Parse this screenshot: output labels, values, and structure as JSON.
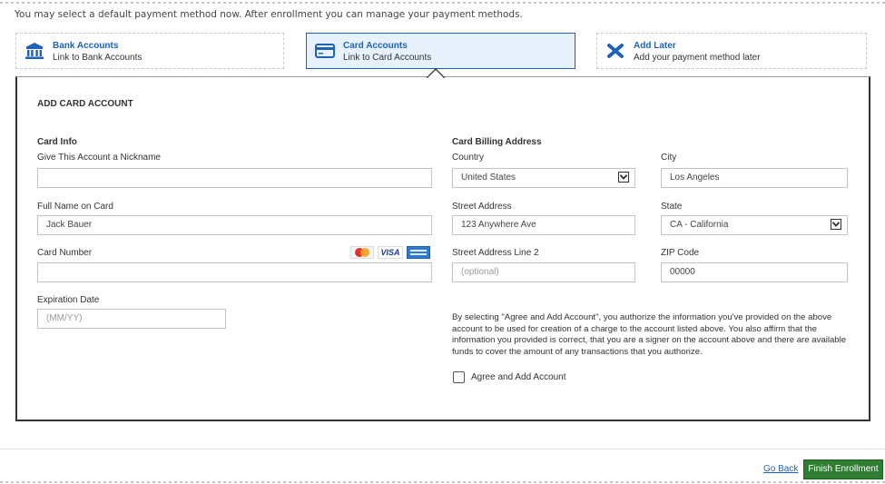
{
  "intro": "You may select a default payment method now. After enrollment you can manage your payment methods.",
  "options": [
    {
      "title": "Bank Accounts",
      "subtitle": "Link to Bank Accounts",
      "icon": "bank-icon",
      "selected": false
    },
    {
      "title": "Card Accounts",
      "subtitle": "Link to Card Accounts",
      "icon": "card-icon",
      "selected": true
    },
    {
      "title": "Add Later",
      "subtitle": "Add your payment method later",
      "icon": "close-x-icon",
      "selected": false
    }
  ],
  "form": {
    "section_title": "ADD CARD ACCOUNT",
    "card_info_heading": "Card Info",
    "nickname_label": "Give This Account a Nickname",
    "nickname_value": "",
    "fullname_label": "Full Name on Card",
    "fullname_value": "Jack Bauer",
    "cardnumber_label": "Card Number",
    "cardnumber_value": "",
    "card_brands": [
      "MasterCard",
      "VISA",
      "AMERICAN EXPRESS"
    ],
    "expiration_label": "Expiration Date",
    "expiration_placeholder": "(MM/YY)",
    "billing_heading": "Card Billing Address",
    "country_label": "Country",
    "country_value": "United States",
    "city_label": "City",
    "city_value": "Los Angeles",
    "street_label": "Street Address",
    "street_value": "123 Anywhere Ave",
    "state_label": "State",
    "state_value": "CA - California",
    "street2_label": "Street Address Line 2",
    "street2_placeholder": "(optional)",
    "zip_label": "ZIP Code",
    "zip_value": "00000",
    "legal_text": "By selecting \"Agree and Add Account\", you authorize the information you've provided on the above account to be used for creation of a charge to the account listed above. You also affirm that the information you provided is correct, that you are a signer on the account above and there are available funds to cover the amount of any transactions that you authorize.",
    "agree_label": "Agree and Add Account",
    "agree_checked": false
  },
  "footer": {
    "go_back": "Go Back",
    "finish": "Finish Enrollment"
  },
  "colors": {
    "accent": "#1f63b7",
    "selected_bg": "#e7f1fb",
    "finish_bg": "#2e7d32"
  }
}
